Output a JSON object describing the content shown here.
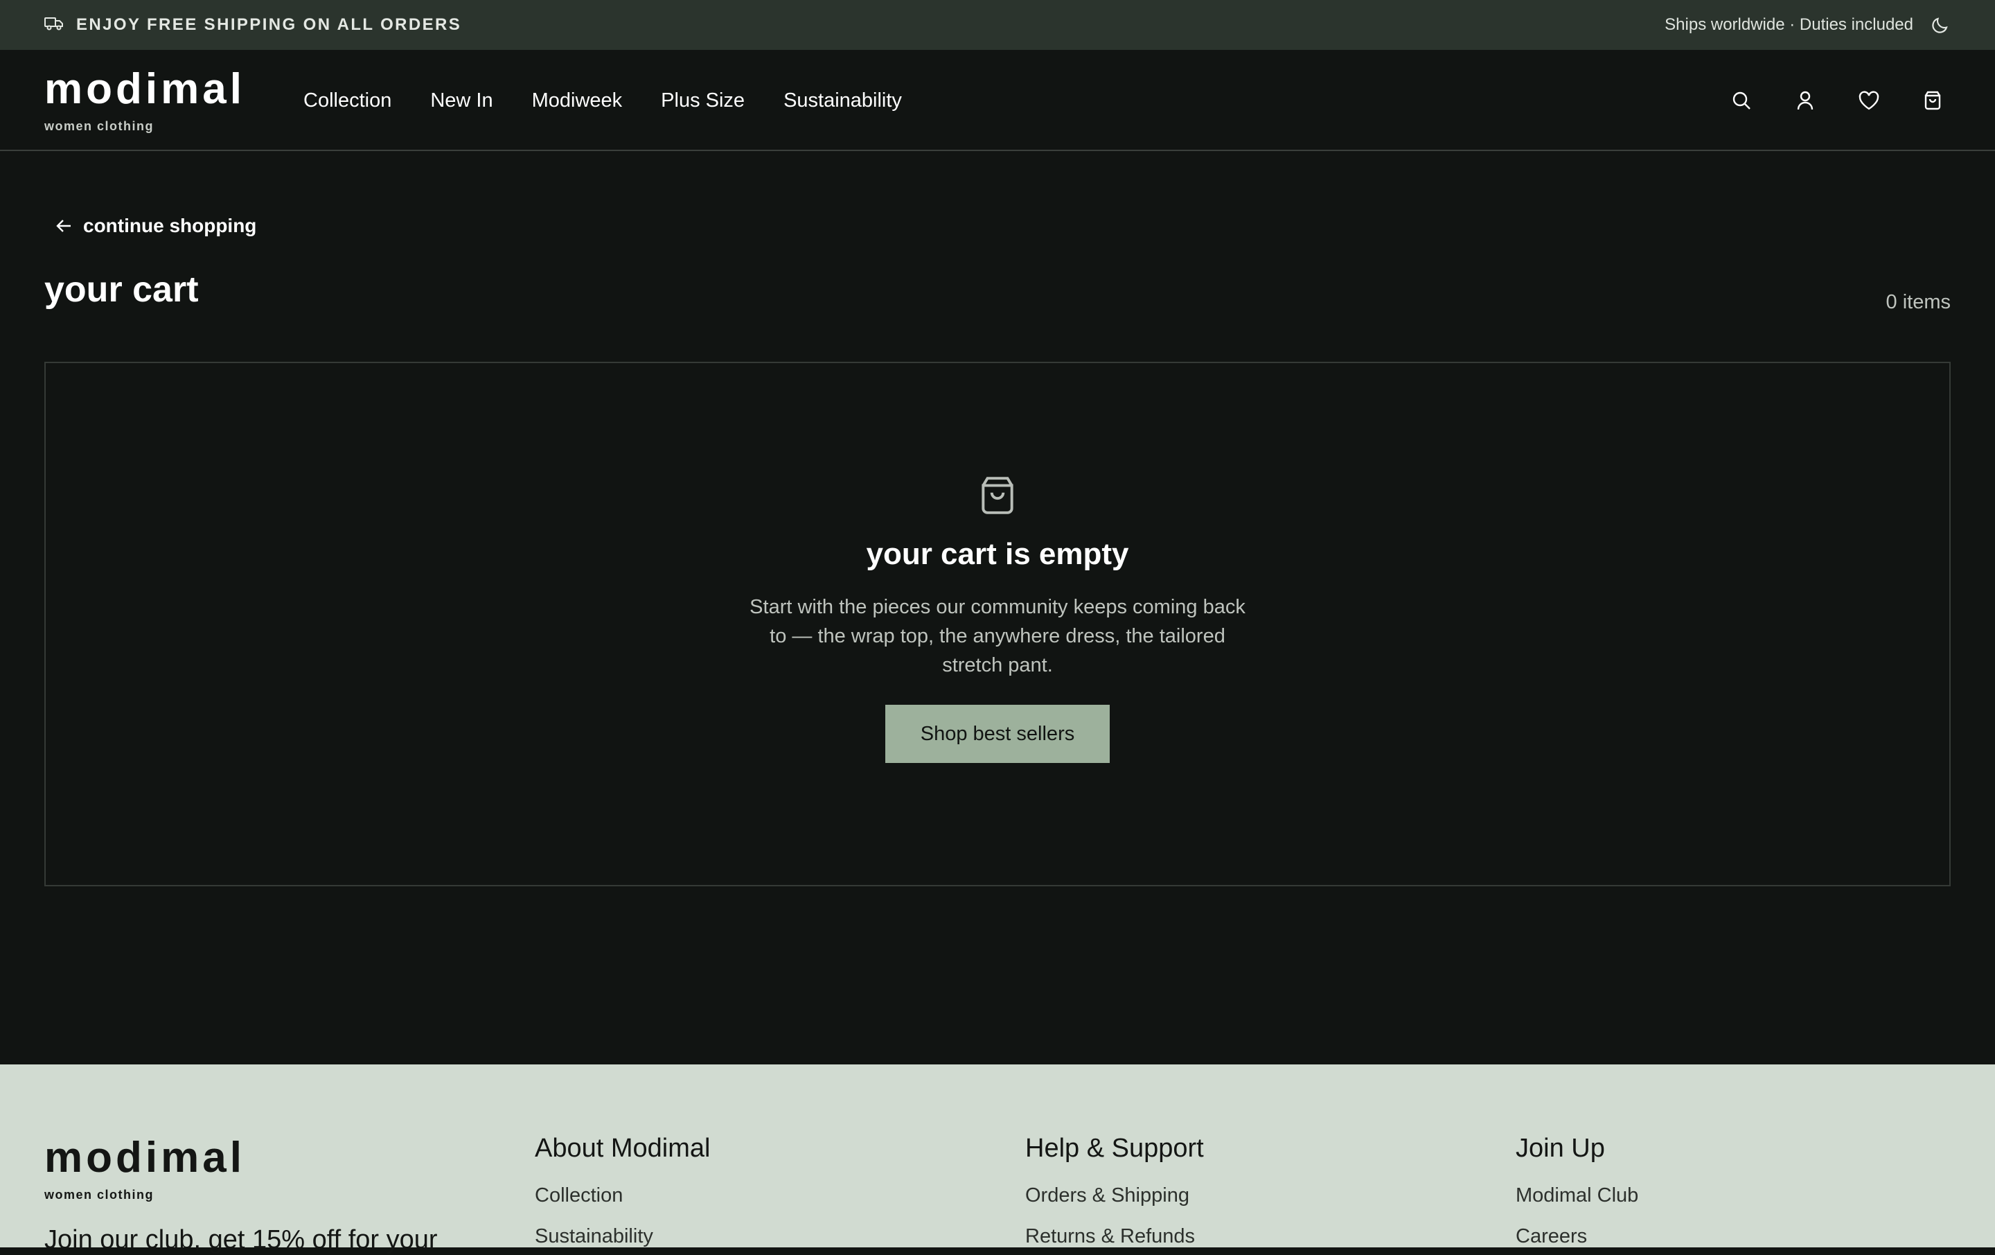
{
  "topbar": {
    "promo": "ENJOY FREE SHIPPING ON ALL ORDERS",
    "shipping_note": "Ships worldwide · Duties included",
    "promo_icon": "truck-icon",
    "theme_icon": "moon-icon"
  },
  "header": {
    "logo": "modimal",
    "logo_sub": "women clothing",
    "nav": [
      "Collection",
      "New In",
      "Modiweek",
      "Plus Size",
      "Sustainability"
    ],
    "icons": [
      "search-icon",
      "user-icon",
      "heart-icon",
      "shopping-bag-icon"
    ]
  },
  "cart": {
    "back_label": "continue shopping",
    "title": "your cart",
    "count": "0 items",
    "empty_title": "your cart is empty",
    "empty_desc": "Start with the pieces our community keeps coming back to — the wrap top, the anywhere dress, the tailored stretch pant.",
    "cta": "Shop best sellers"
  },
  "footer": {
    "logo": "modimal",
    "logo_sub": "women clothing",
    "tagline": "Join our club, get 15% off for your",
    "columns": [
      {
        "title": "About Modimal",
        "links": [
          "Collection",
          "Sustainability"
        ]
      },
      {
        "title": "Help & Support",
        "links": [
          "Orders & Shipping",
          "Returns & Refunds"
        ]
      },
      {
        "title": "Join Up",
        "links": [
          "Modimal Club",
          "Careers"
        ]
      }
    ]
  },
  "colors": {
    "background": "#111412",
    "topbar": "#2b342d",
    "accent_button": "#9db19c",
    "footer": "#d1dbd1"
  }
}
